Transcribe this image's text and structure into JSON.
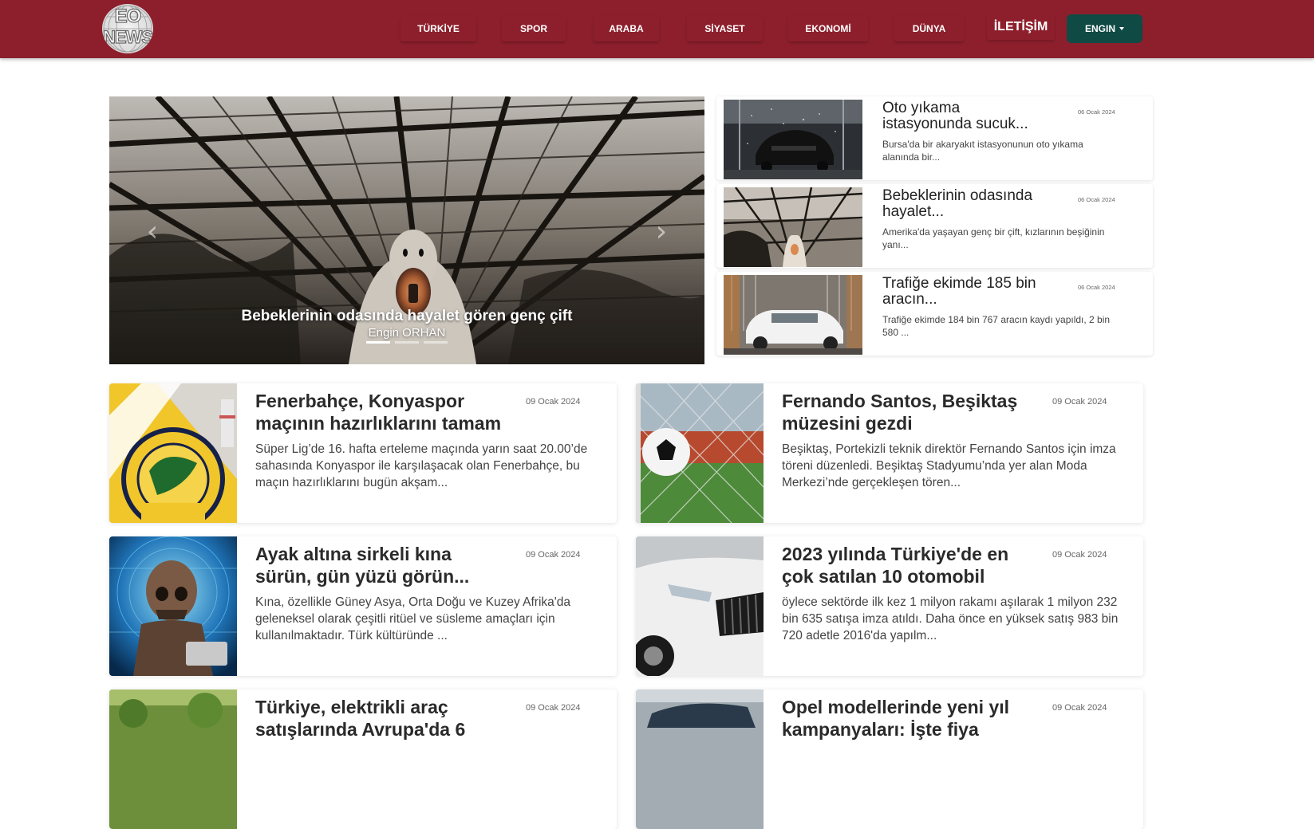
{
  "logo": {
    "line1": "EO",
    "line2": "NEWS"
  },
  "nav": {
    "items": [
      {
        "label": "TÜRKİYE"
      },
      {
        "label": "SPOR"
      },
      {
        "label": "ARABA"
      },
      {
        "label": "SİYASET"
      },
      {
        "label": "EKONOMİ"
      },
      {
        "label": "DÜNYA"
      },
      {
        "label": "İLETİŞİM"
      }
    ],
    "user_label": "ENGIN"
  },
  "hero": {
    "title": "Bebeklerinin odasında hayalet gören genç çift",
    "author": "Engin ORHAN",
    "prev_arrow": "‹",
    "next_arrow": "›",
    "slide_count": 3,
    "active_slide": 1
  },
  "side_news": [
    {
      "title": "Oto yıkama istasyonunda sucuk...",
      "date": "06 Ocak 2024",
      "desc": "Bursa'da bir akaryakıt istasyonunun oto yıkama alanında bir..."
    },
    {
      "title": "Bebeklerinin odasında hayalet...",
      "date": "06 Ocak 2024",
      "desc": "Amerika'da yaşayan genç bir çift, kızlarının beşiğinin yanı..."
    },
    {
      "title": "Trafiğe ekimde 185 bin aracın...",
      "date": "06 Ocak 2024",
      "desc": "Trafiğe ekimde 184 bin 767 aracın kaydı yapıldı, 2 bin 580 ..."
    }
  ],
  "news": [
    {
      "title": "Fenerbahçe, Konyaspor maçının hazırlıklarını tamam",
      "date": "09 Ocak 2024",
      "desc": "Süper Lig’de 16. hafta erteleme maçında yarın saat 20.00’de sahasında Konyaspor ile karşılaşacak olan Fenerbahçe, bu maçın hazırlıklarını bugün akşam..."
    },
    {
      "title": "Fernando Santos, Beşiktaş müzesini gezdi",
      "date": "09 Ocak 2024",
      "desc": "Beşiktaş, Portekizli teknik direktör Fernando Santos için imza töreni düzenledi. Beşiktaş Stadyumu’nda yer alan Moda Merkezi’nde gerçekleşen tören..."
    },
    {
      "title": "Ayak altına sirkeli kına sürün, gün yüzü görün...",
      "date": "09 Ocak 2024",
      "desc": "Kına, özellikle Güney Asya, Orta Doğu ve Kuzey Afrika'da geleneksel olarak çeşitli ritüel ve süsleme amaçları için kullanılmaktadır. Türk kültüründe ..."
    },
    {
      "title": "2023 yılında Türkiye'de en çok satılan 10 otomobil",
      "date": "09 Ocak 2024",
      "desc": "öylece sektörde ilk kez 1 milyon rakamı aşılarak 1 milyon 232 bin 635 satışa imza atıldı. Daha önce en yüksek satış 983 bin 720 adetle 2016'da yapılm..."
    },
    {
      "title": "Türkiye, elektrikli araç satışlarında Avrupa'da 6",
      "date": "09 Ocak 2024",
      "desc": ""
    },
    {
      "title": "Opel modellerinde yeni yıl kampanyaları: İşte fiya",
      "date": "09 Ocak 2024",
      "desc": ""
    }
  ]
}
